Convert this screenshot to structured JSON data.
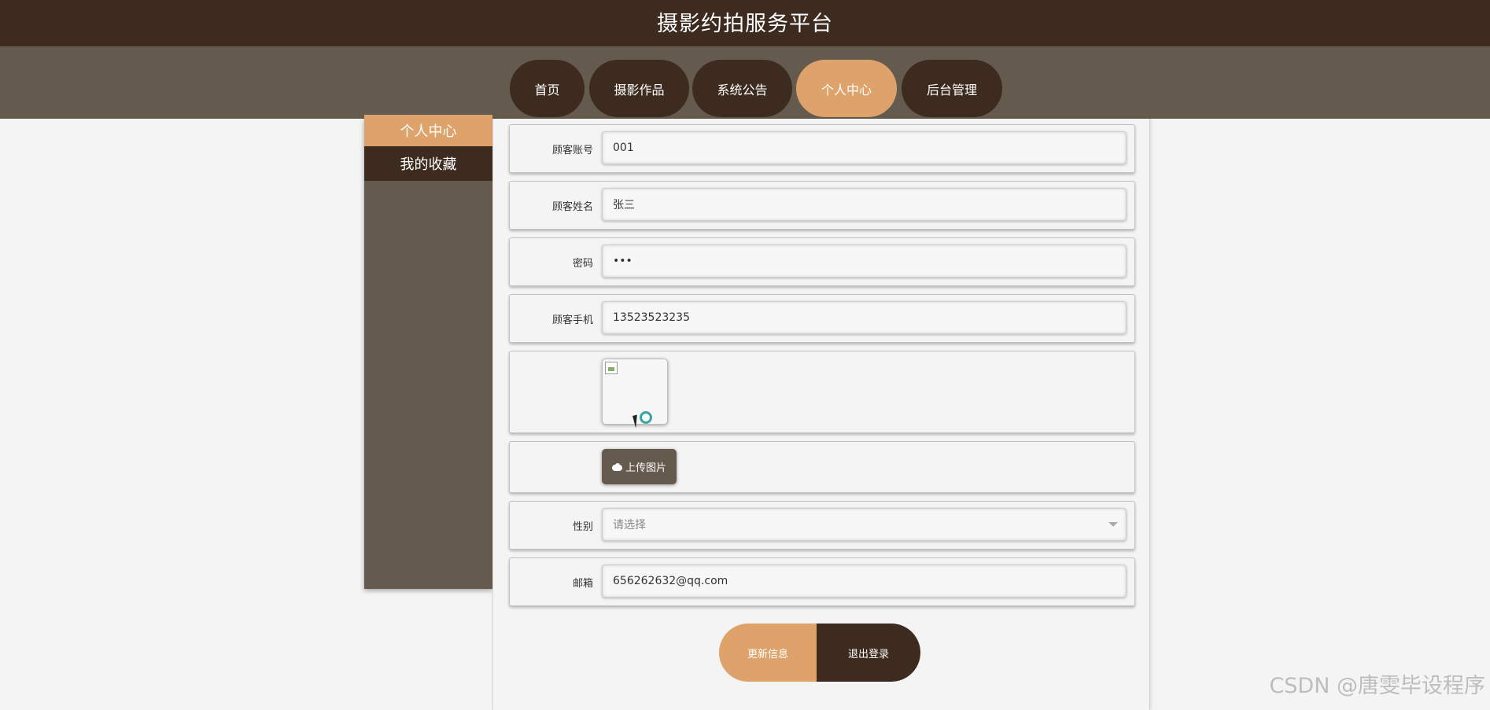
{
  "header": {
    "title": "摄影约拍服务平台"
  },
  "nav": {
    "items": [
      {
        "label": "首页"
      },
      {
        "label": "摄影作品"
      },
      {
        "label": "系统公告"
      },
      {
        "label": "个人中心"
      },
      {
        "label": "后台管理"
      }
    ],
    "active_index": 3
  },
  "sidebar": {
    "items": [
      {
        "label": "个人中心"
      },
      {
        "label": "我的收藏"
      }
    ]
  },
  "form": {
    "account": {
      "label": "顾客账号",
      "value": "001"
    },
    "name": {
      "label": "顾客姓名",
      "value": "张三"
    },
    "password": {
      "label": "密码",
      "value": "•••"
    },
    "phone": {
      "label": "顾客手机",
      "value": "13523523235"
    },
    "upload": {
      "label": "上传图片"
    },
    "gender": {
      "label": "性别",
      "placeholder": "请选择"
    },
    "email": {
      "label": "邮箱",
      "value": "656262632@qq.com"
    }
  },
  "actions": {
    "update": "更新信息",
    "logout": "退出登录"
  },
  "watermark": "CSDN @唐雯毕设程序",
  "colors": {
    "dark": "#3e2b20",
    "mid": "#655a4e",
    "accent": "#dea36a"
  }
}
